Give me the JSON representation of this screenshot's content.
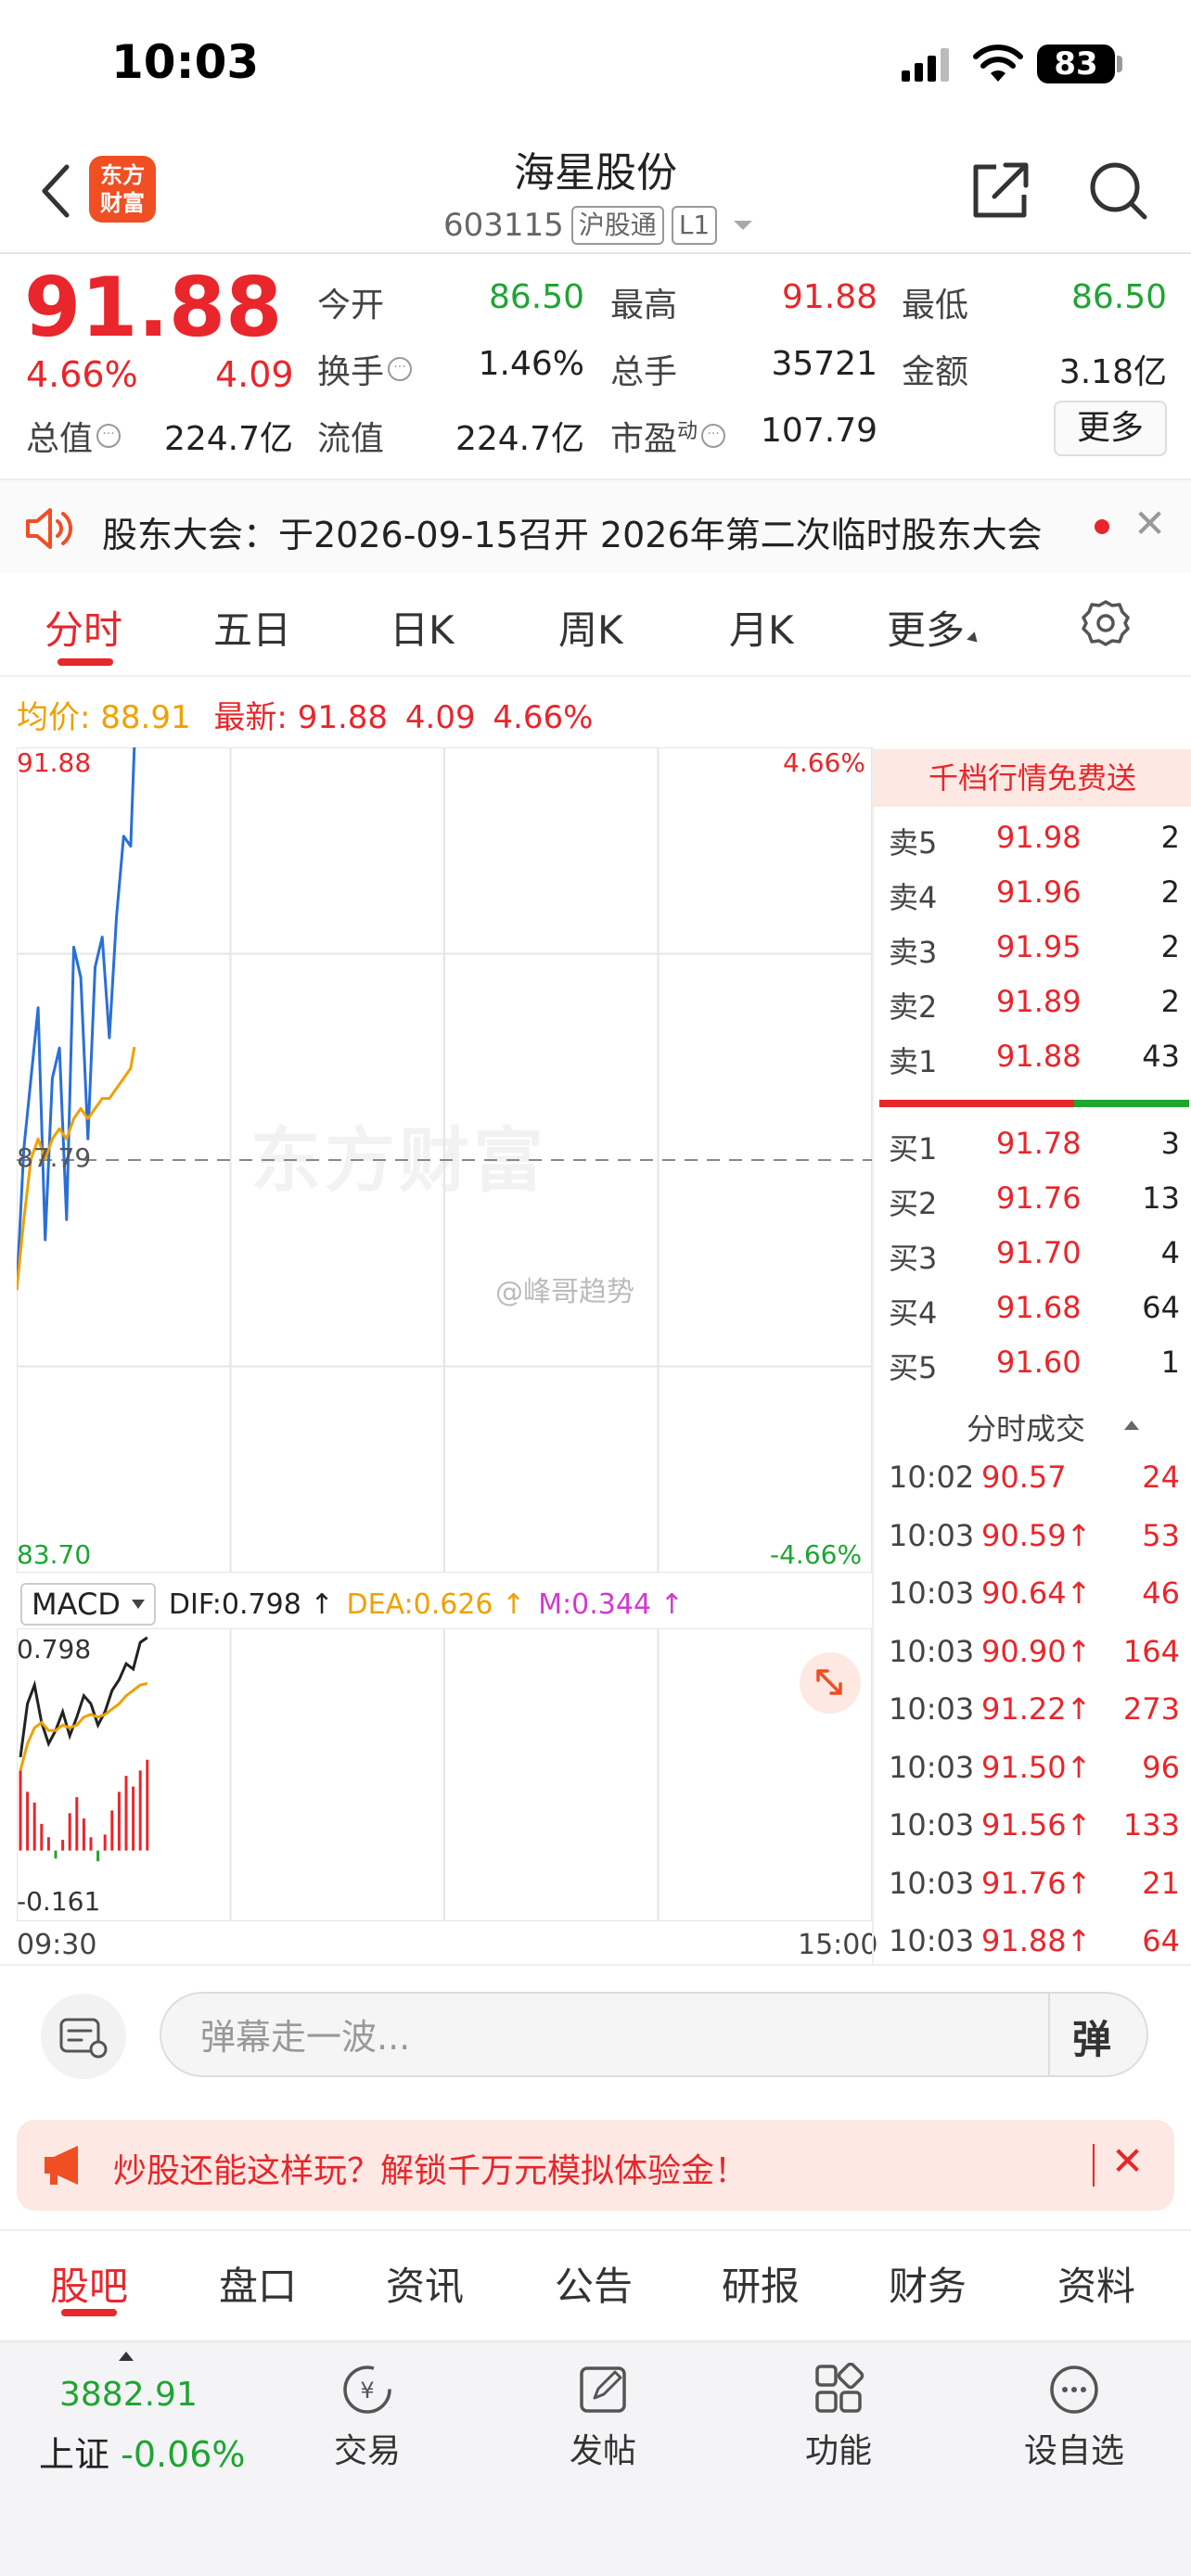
{
  "status": {
    "time": "10:03",
    "battery": "83"
  },
  "header": {
    "logo_line1": "东方",
    "logo_line2": "财富",
    "name": "海星股份",
    "code": "603115",
    "tag1": "沪股通",
    "tag2": "L1"
  },
  "quote": {
    "price": "91.88",
    "pct": "4.66%",
    "chg": "4.09",
    "open_label": "今开",
    "open": "86.50",
    "high_label": "最高",
    "high": "91.88",
    "low_label": "最低",
    "low": "86.50",
    "turnover_label": "换手",
    "turnover": "1.46%",
    "volume_label": "总手",
    "volume": "35721",
    "amount_label": "金额",
    "amount": "3.18亿",
    "totalcap_label": "总值",
    "totalcap": "224.7亿",
    "floatcap_label": "流值",
    "floatcap": "224.7亿",
    "pe_label": "市盈",
    "pe_sup": "动",
    "pe": "107.79",
    "more": "更多"
  },
  "notice": {
    "text": "股东大会：于2026-09-15召开 2026年第二次临时股东大会"
  },
  "tabs": [
    "分时",
    "五日",
    "日K",
    "周K",
    "月K",
    "更多"
  ],
  "infoline": {
    "avg_label": "均价:",
    "avg": "88.91",
    "latest_label": "最新:",
    "latest": "91.88",
    "chg": "4.09",
    "pct": "4.66%"
  },
  "chart": {
    "y_top": "91.88",
    "y_mid": "87.79",
    "y_bottom": "83.70",
    "pct_top": "4.66%",
    "pct_bottom": "-4.66%",
    "time_start": "09:30",
    "time_end": "15:00",
    "watermark": "东方财富",
    "weibo": "@峰哥趋势"
  },
  "chart_data": {
    "type": "line",
    "x": [
      "09:30",
      "09:32",
      "09:34",
      "09:36",
      "09:38",
      "09:40",
      "09:42",
      "09:44",
      "09:46",
      "09:48",
      "09:50",
      "09:52",
      "09:54",
      "09:56",
      "09:58",
      "10:00",
      "10:02",
      "10:03"
    ],
    "series": [
      {
        "name": "price",
        "values": [
          86.5,
          87.9,
          88.6,
          89.3,
          87.0,
          88.6,
          88.9,
          87.2,
          89.9,
          89.6,
          88.0,
          89.7,
          90.0,
          89.0,
          90.2,
          91.0,
          90.9,
          91.88
        ],
        "color": "#2b6fd6"
      },
      {
        "name": "avg",
        "values": [
          86.5,
          87.2,
          87.8,
          88.0,
          87.8,
          88.0,
          88.1,
          88.0,
          88.2,
          88.3,
          88.2,
          88.3,
          88.4,
          88.4,
          88.5,
          88.6,
          88.7,
          88.91
        ],
        "color": "#f0a000"
      }
    ],
    "ylim": [
      83.7,
      91.88
    ],
    "grid": true
  },
  "macd": {
    "label": "MACD",
    "dif": "DIF:0.798 ↑",
    "dea": "DEA:0.626 ↑",
    "m": "M:0.344 ↑",
    "top": "0.798",
    "bottom": "-0.161"
  },
  "orderbook": {
    "banner": "千档行情免费送",
    "asks": [
      {
        "label": "卖5",
        "price": "91.98",
        "vol": "2"
      },
      {
        "label": "卖4",
        "price": "91.96",
        "vol": "2"
      },
      {
        "label": "卖3",
        "price": "91.95",
        "vol": "2"
      },
      {
        "label": "卖2",
        "price": "91.89",
        "vol": "2"
      },
      {
        "label": "卖1",
        "price": "91.88",
        "vol": "43"
      }
    ],
    "bids": [
      {
        "label": "买1",
        "price": "91.78",
        "vol": "3"
      },
      {
        "label": "买2",
        "price": "91.76",
        "vol": "13"
      },
      {
        "label": "买3",
        "price": "91.70",
        "vol": "4"
      },
      {
        "label": "买4",
        "price": "91.68",
        "vol": "64"
      },
      {
        "label": "买5",
        "price": "91.60",
        "vol": "1"
      }
    ],
    "ticks_title": "分时成交",
    "ticks": [
      {
        "time": "10:02",
        "price": "90.57",
        "vol": "24"
      },
      {
        "time": "10:03",
        "price": "90.59↑",
        "vol": "53"
      },
      {
        "time": "10:03",
        "price": "90.64↑",
        "vol": "46"
      },
      {
        "time": "10:03",
        "price": "90.90↑",
        "vol": "164"
      },
      {
        "time": "10:03",
        "price": "91.22↑",
        "vol": "273"
      },
      {
        "time": "10:03",
        "price": "91.50↑",
        "vol": "96"
      },
      {
        "time": "10:03",
        "price": "91.56↑",
        "vol": "133"
      },
      {
        "time": "10:03",
        "price": "91.76↑",
        "vol": "21"
      },
      {
        "time": "10:03",
        "price": "91.88↑",
        "vol": "64"
      }
    ]
  },
  "comment": {
    "placeholder": "弹幕走一波...",
    "danmu": "弹"
  },
  "promo": {
    "text": "炒股还能这样玩？解锁千万元模拟体验金！"
  },
  "bottom_tabs": [
    "股吧",
    "盘口",
    "资讯",
    "公告",
    "研报",
    "财务",
    "资料"
  ],
  "bottom_nav": {
    "index_value": "3882.91",
    "index_name": "上证",
    "index_pct": "-0.06%",
    "items": [
      "交易",
      "发帖",
      "功能",
      "设自选"
    ]
  }
}
